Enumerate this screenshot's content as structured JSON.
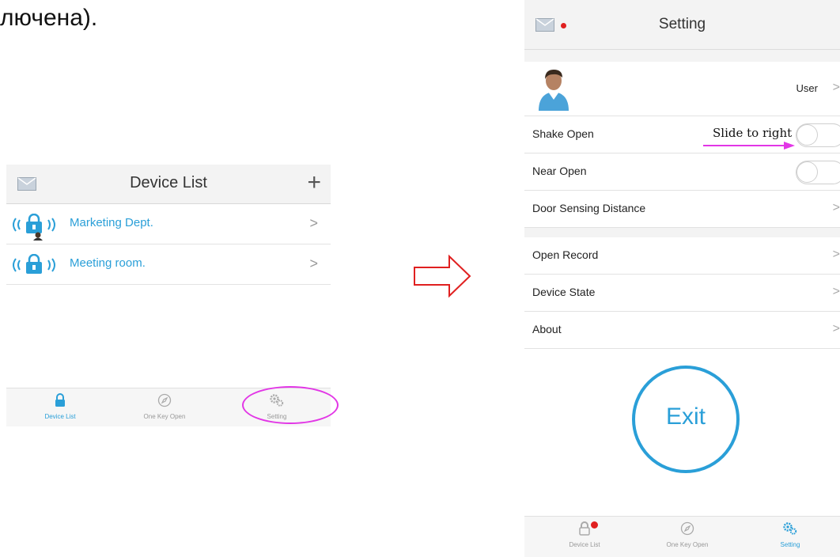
{
  "caption": "лючена).",
  "left_screen": {
    "title": "Device List",
    "plus_label": "+",
    "devices": [
      {
        "name": "Marketing Dept.",
        "chevron": ">"
      },
      {
        "name": "Meeting room.",
        "chevron": ">"
      }
    ],
    "tabs": [
      {
        "label": "Device List",
        "icon": "lock-icon"
      },
      {
        "label": "One Key Open",
        "icon": "compass-icon"
      },
      {
        "label": "Setting",
        "icon": "gears-icon"
      }
    ]
  },
  "right_screen": {
    "title": "Setting",
    "user_label": "User",
    "rows": {
      "shake_open": "Shake Open",
      "near_open": "Near Open",
      "door_sensing": "Door Sensing Distance",
      "open_record": "Open Record",
      "device_state": "Device State",
      "about": "About"
    },
    "chevron": ">",
    "hint": "Slide to right",
    "exit_label": "Exit",
    "tabs": [
      {
        "label": "Device List",
        "icon": "lock-icon"
      },
      {
        "label": "One Key Open",
        "icon": "compass-icon"
      },
      {
        "label": "Setting",
        "icon": "gears-icon"
      }
    ]
  },
  "colors": {
    "accent": "#2a9fd8",
    "highlight": "#e236e6",
    "arrow": "#e02020",
    "badge": "#e02020"
  }
}
